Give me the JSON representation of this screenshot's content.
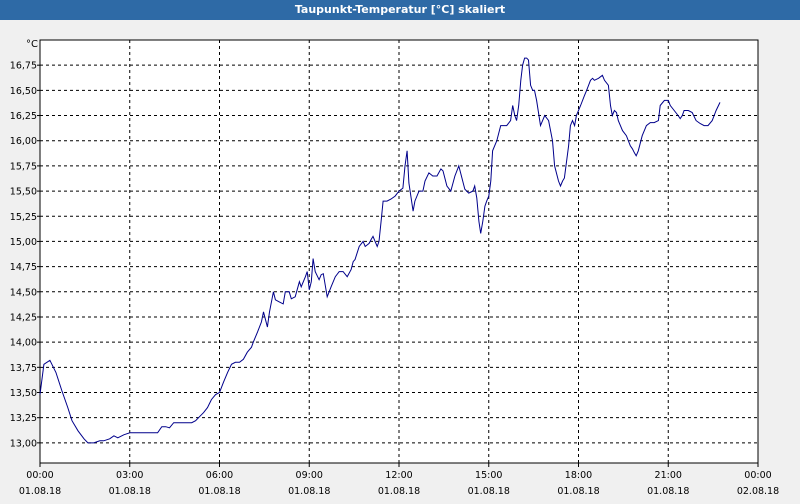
{
  "window": {
    "title": "Taupunkt-Temperatur [°C] skaliert"
  },
  "colors": {
    "titlebar": "#2e6aa6",
    "line": "#00008b",
    "grid": "#000000",
    "background": "#f0f0f0",
    "plot": "#ffffff"
  },
  "chart_data": {
    "type": "line",
    "title": "Taupunkt-Temperatur [°C] skaliert",
    "ylabel": "°C",
    "xlabel": "",
    "grid": true,
    "xlim": [
      0,
      24
    ],
    "ylim": [
      12.8,
      17.0
    ],
    "x_unit": "hours since 01.08.18 00:00",
    "x_ticks": [
      {
        "value": 0,
        "time": "00:00",
        "date": "01.08.18"
      },
      {
        "value": 3,
        "time": "03:00",
        "date": "01.08.18"
      },
      {
        "value": 6,
        "time": "06:00",
        "date": "01.08.18"
      },
      {
        "value": 9,
        "time": "09:00",
        "date": "01.08.18"
      },
      {
        "value": 12,
        "time": "12:00",
        "date": "01.08.18"
      },
      {
        "value": 15,
        "time": "15:00",
        "date": "01.08.18"
      },
      {
        "value": 18,
        "time": "18:00",
        "date": "01.08.18"
      },
      {
        "value": 21,
        "time": "21:00",
        "date": "01.08.18"
      },
      {
        "value": 24,
        "time": "00:00",
        "date": "02.08.18"
      }
    ],
    "y_ticks": [
      {
        "value": 13.0,
        "label": "13,00"
      },
      {
        "value": 13.25,
        "label": "13,25"
      },
      {
        "value": 13.5,
        "label": "13,50"
      },
      {
        "value": 13.75,
        "label": "13,75"
      },
      {
        "value": 14.0,
        "label": "14,00"
      },
      {
        "value": 14.25,
        "label": "14,25"
      },
      {
        "value": 14.5,
        "label": "14,50"
      },
      {
        "value": 14.75,
        "label": "14,75"
      },
      {
        "value": 15.0,
        "label": "15,00"
      },
      {
        "value": 15.25,
        "label": "15,25"
      },
      {
        "value": 15.5,
        "label": "15,50"
      },
      {
        "value": 15.75,
        "label": "15,75"
      },
      {
        "value": 16.0,
        "label": "16,00"
      },
      {
        "value": 16.25,
        "label": "16,25"
      },
      {
        "value": 16.5,
        "label": "16,50"
      },
      {
        "value": 16.75,
        "label": "16,75"
      }
    ],
    "series": [
      {
        "color": "#00008b",
        "points": [
          [
            0.0,
            13.48
          ],
          [
            0.13,
            13.78
          ],
          [
            0.33,
            13.82
          ],
          [
            0.53,
            13.7
          ],
          [
            0.73,
            13.52
          ],
          [
            0.93,
            13.35
          ],
          [
            1.07,
            13.22
          ],
          [
            1.27,
            13.12
          ],
          [
            1.47,
            13.04
          ],
          [
            1.6,
            13.0
          ],
          [
            1.8,
            13.0
          ],
          [
            2.0,
            13.02
          ],
          [
            2.13,
            13.02
          ],
          [
            2.33,
            13.04
          ],
          [
            2.47,
            13.07
          ],
          [
            2.6,
            13.05
          ],
          [
            2.8,
            13.08
          ],
          [
            3.0,
            13.1
          ],
          [
            3.2,
            13.1
          ],
          [
            3.33,
            13.1
          ],
          [
            3.53,
            13.1
          ],
          [
            3.73,
            13.1
          ],
          [
            3.93,
            13.1
          ],
          [
            4.07,
            13.16
          ],
          [
            4.2,
            13.16
          ],
          [
            4.33,
            13.15
          ],
          [
            4.47,
            13.2
          ],
          [
            4.67,
            13.2
          ],
          [
            4.8,
            13.2
          ],
          [
            4.93,
            13.2
          ],
          [
            5.07,
            13.2
          ],
          [
            5.2,
            13.22
          ],
          [
            5.33,
            13.26
          ],
          [
            5.47,
            13.3
          ],
          [
            5.6,
            13.35
          ],
          [
            5.73,
            13.43
          ],
          [
            5.87,
            13.48
          ],
          [
            6.0,
            13.5
          ],
          [
            6.13,
            13.6
          ],
          [
            6.27,
            13.7
          ],
          [
            6.4,
            13.78
          ],
          [
            6.53,
            13.8
          ],
          [
            6.67,
            13.8
          ],
          [
            6.8,
            13.83
          ],
          [
            6.93,
            13.9
          ],
          [
            7.07,
            13.95
          ],
          [
            7.13,
            14.0
          ],
          [
            7.27,
            14.1
          ],
          [
            7.4,
            14.2
          ],
          [
            7.47,
            14.3
          ],
          [
            7.6,
            14.15
          ],
          [
            7.67,
            14.3
          ],
          [
            7.8,
            14.5
          ],
          [
            7.87,
            14.42
          ],
          [
            8.0,
            14.4
          ],
          [
            8.13,
            14.38
          ],
          [
            8.2,
            14.5
          ],
          [
            8.33,
            14.5
          ],
          [
            8.4,
            14.43
          ],
          [
            8.53,
            14.45
          ],
          [
            8.67,
            14.6
          ],
          [
            8.73,
            14.55
          ],
          [
            8.87,
            14.65
          ],
          [
            8.93,
            14.7
          ],
          [
            9.0,
            14.52
          ],
          [
            9.07,
            14.6
          ],
          [
            9.13,
            14.83
          ],
          [
            9.2,
            14.7
          ],
          [
            9.33,
            14.62
          ],
          [
            9.4,
            14.67
          ],
          [
            9.47,
            14.68
          ],
          [
            9.6,
            14.45
          ],
          [
            9.73,
            14.55
          ],
          [
            9.87,
            14.65
          ],
          [
            10.0,
            14.7
          ],
          [
            10.13,
            14.7
          ],
          [
            10.27,
            14.65
          ],
          [
            10.4,
            14.72
          ],
          [
            10.47,
            14.8
          ],
          [
            10.53,
            14.82
          ],
          [
            10.67,
            14.95
          ],
          [
            10.8,
            15.0
          ],
          [
            10.87,
            14.95
          ],
          [
            11.0,
            14.98
          ],
          [
            11.07,
            15.02
          ],
          [
            11.13,
            15.05
          ],
          [
            11.27,
            14.95
          ],
          [
            11.33,
            15.0
          ],
          [
            11.4,
            15.2
          ],
          [
            11.47,
            15.4
          ],
          [
            11.6,
            15.4
          ],
          [
            11.73,
            15.42
          ],
          [
            11.87,
            15.45
          ],
          [
            12.0,
            15.5
          ],
          [
            12.13,
            15.53
          ],
          [
            12.2,
            15.75
          ],
          [
            12.27,
            15.9
          ],
          [
            12.33,
            15.58
          ],
          [
            12.47,
            15.3
          ],
          [
            12.53,
            15.4
          ],
          [
            12.67,
            15.5
          ],
          [
            12.8,
            15.5
          ],
          [
            12.87,
            15.6
          ],
          [
            13.0,
            15.68
          ],
          [
            13.13,
            15.65
          ],
          [
            13.27,
            15.65
          ],
          [
            13.4,
            15.72
          ],
          [
            13.47,
            15.7
          ],
          [
            13.6,
            15.55
          ],
          [
            13.73,
            15.5
          ],
          [
            13.87,
            15.65
          ],
          [
            14.0,
            15.75
          ],
          [
            14.13,
            15.6
          ],
          [
            14.2,
            15.52
          ],
          [
            14.33,
            15.48
          ],
          [
            14.47,
            15.5
          ],
          [
            14.53,
            15.55
          ],
          [
            14.6,
            15.43
          ],
          [
            14.67,
            15.2
          ],
          [
            14.73,
            15.08
          ],
          [
            14.8,
            15.2
          ],
          [
            14.87,
            15.35
          ],
          [
            14.93,
            15.4
          ],
          [
            15.0,
            15.45
          ],
          [
            15.07,
            15.6
          ],
          [
            15.13,
            15.9
          ],
          [
            15.27,
            16.0
          ],
          [
            15.4,
            16.15
          ],
          [
            15.53,
            16.15
          ],
          [
            15.6,
            16.15
          ],
          [
            15.73,
            16.2
          ],
          [
            15.8,
            16.35
          ],
          [
            15.87,
            16.25
          ],
          [
            15.93,
            16.2
          ],
          [
            16.0,
            16.35
          ],
          [
            16.07,
            16.6
          ],
          [
            16.13,
            16.75
          ],
          [
            16.2,
            16.82
          ],
          [
            16.27,
            16.82
          ],
          [
            16.33,
            16.8
          ],
          [
            16.4,
            16.55
          ],
          [
            16.47,
            16.5
          ],
          [
            16.53,
            16.5
          ],
          [
            16.6,
            16.4
          ],
          [
            16.73,
            16.15
          ],
          [
            16.8,
            16.2
          ],
          [
            16.87,
            16.25
          ],
          [
            17.0,
            16.2
          ],
          [
            17.13,
            16.0
          ],
          [
            17.2,
            15.75
          ],
          [
            17.33,
            15.6
          ],
          [
            17.4,
            15.55
          ],
          [
            17.47,
            15.6
          ],
          [
            17.53,
            15.63
          ],
          [
            17.67,
            15.95
          ],
          [
            17.73,
            16.15
          ],
          [
            17.8,
            16.2
          ],
          [
            17.87,
            16.15
          ],
          [
            17.93,
            16.25
          ],
          [
            18.07,
            16.35
          ],
          [
            18.2,
            16.45
          ],
          [
            18.27,
            16.5
          ],
          [
            18.4,
            16.6
          ],
          [
            18.47,
            16.62
          ],
          [
            18.53,
            16.6
          ],
          [
            18.67,
            16.62
          ],
          [
            18.8,
            16.65
          ],
          [
            18.87,
            16.6
          ],
          [
            19.0,
            16.55
          ],
          [
            19.07,
            16.35
          ],
          [
            19.13,
            16.25
          ],
          [
            19.2,
            16.3
          ],
          [
            19.27,
            16.28
          ],
          [
            19.33,
            16.2
          ],
          [
            19.47,
            16.1
          ],
          [
            19.6,
            16.05
          ],
          [
            19.73,
            15.95
          ],
          [
            19.8,
            15.92
          ],
          [
            19.87,
            15.88
          ],
          [
            19.93,
            15.85
          ],
          [
            20.0,
            15.9
          ],
          [
            20.13,
            16.05
          ],
          [
            20.27,
            16.15
          ],
          [
            20.4,
            16.18
          ],
          [
            20.53,
            16.18
          ],
          [
            20.67,
            16.2
          ],
          [
            20.73,
            16.35
          ],
          [
            20.87,
            16.4
          ],
          [
            21.0,
            16.4
          ],
          [
            21.07,
            16.35
          ],
          [
            21.2,
            16.3
          ],
          [
            21.33,
            16.25
          ],
          [
            21.4,
            16.22
          ],
          [
            21.47,
            16.25
          ],
          [
            21.53,
            16.3
          ],
          [
            21.67,
            16.3
          ],
          [
            21.8,
            16.28
          ],
          [
            21.93,
            16.2
          ],
          [
            22.07,
            16.17
          ],
          [
            22.2,
            16.15
          ],
          [
            22.33,
            16.15
          ],
          [
            22.47,
            16.2
          ],
          [
            22.6,
            16.3
          ],
          [
            22.73,
            16.38
          ]
        ]
      }
    ]
  }
}
